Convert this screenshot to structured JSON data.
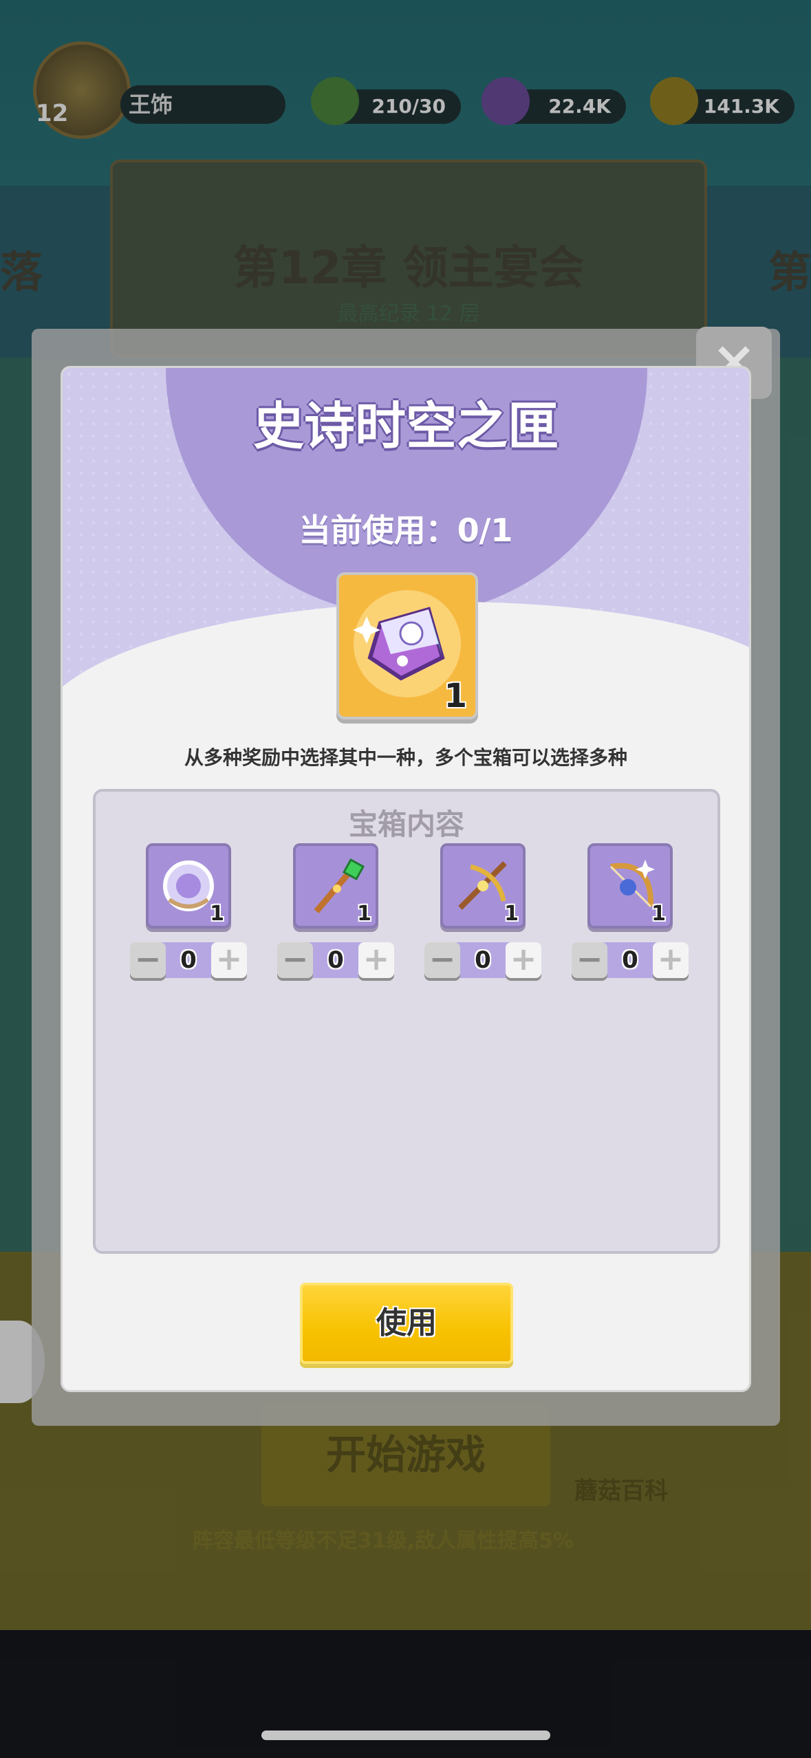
{
  "background": {
    "player": {
      "level": "12",
      "name": "王饰"
    },
    "resources": [
      {
        "icon": "energy-icon",
        "value": "210/30"
      },
      {
        "icon": "gem-icon",
        "value": "22.4K"
      },
      {
        "icon": "coin-icon",
        "value": "141.3K"
      }
    ],
    "chapter": {
      "title": "第12章 领主宴会",
      "subtitle": "最高纪录 12 层",
      "left_edge": "落",
      "right_edge": "第"
    },
    "start_game": "开始游戏",
    "mushroom_wiki": "蘑菇百科",
    "warning": "阵容最低等级不足31级,敌人属性提高5%"
  },
  "modal": {
    "title": "史诗时空之匣",
    "usage_label": "当前使用：0/1",
    "item": {
      "icon": "epic-spacetime-box-icon",
      "count": "1"
    },
    "description": "从多种奖励中选择其中一种，多个宝箱可以选择多种",
    "contents_title": "宝箱内容",
    "rewards": [
      {
        "icon": "crystal-ring-icon",
        "count": "1",
        "selected": "0"
      },
      {
        "icon": "emerald-staff-icon",
        "count": "1",
        "selected": "0"
      },
      {
        "icon": "golden-crossbow-icon",
        "count": "1",
        "selected": "0"
      },
      {
        "icon": "star-bow-icon",
        "count": "1",
        "selected": "0"
      }
    ],
    "use_button": "使用",
    "close_glyph": "×",
    "minus_glyph": "−",
    "plus_glyph": "+"
  }
}
